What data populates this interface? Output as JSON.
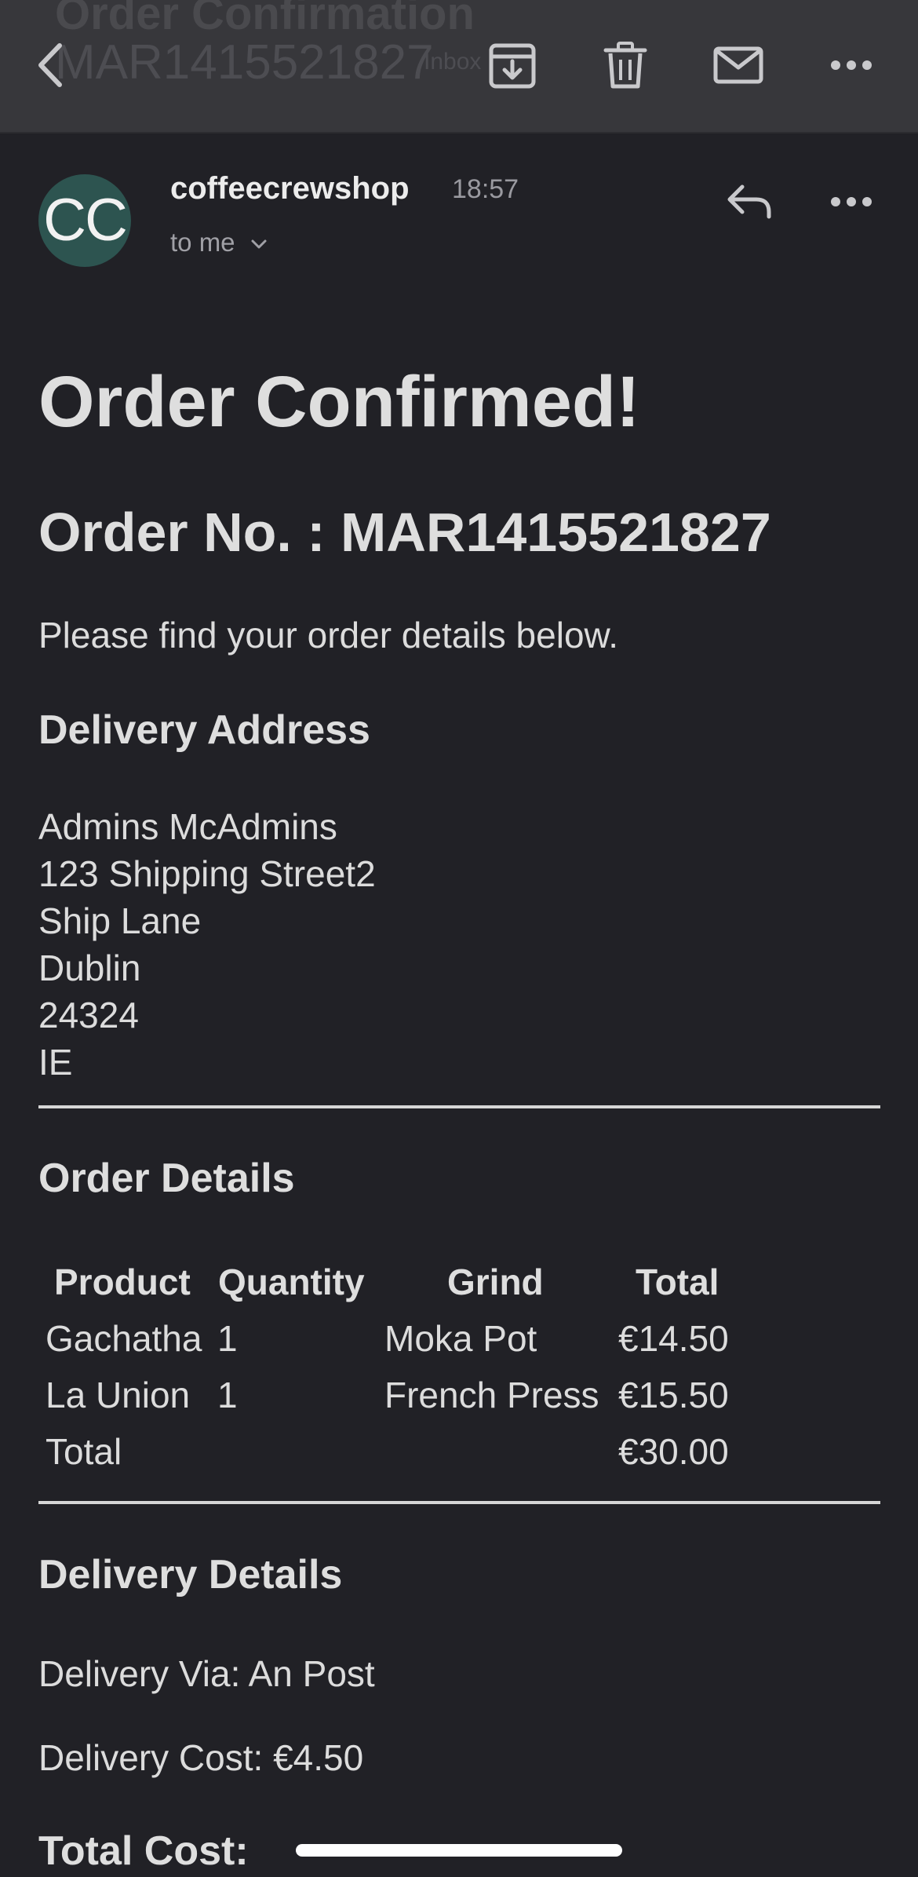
{
  "toolbar": {
    "ghost_subject": "Order Confirmation",
    "ghost_order": "MAR1415521827",
    "ghost_label": "Inbox",
    "icons": [
      "back-icon",
      "archive-icon",
      "trash-icon",
      "mail-icon",
      "more-icon"
    ]
  },
  "message": {
    "avatar_initials": "CC",
    "avatar_color": "#2d5450",
    "sender": "coffeecrewshop",
    "time": "18:57",
    "recipient": "to me"
  },
  "email": {
    "title": "Order Confirmed!",
    "order_number": "Order No. : MAR1415521827",
    "intro": "Please find your order details below.",
    "delivery_address": {
      "heading": "Delivery Address",
      "lines": [
        "Admins McAdmins",
        "123 Shipping Street2",
        "Ship Lane",
        "Dublin",
        "24324",
        "IE"
      ]
    },
    "order_details": {
      "heading": "Order Details",
      "columns": [
        "Product",
        "Quantity",
        "Grind",
        "Total"
      ],
      "rows": [
        {
          "product": "Gachatha",
          "quantity": "1",
          "grind": "Moka Pot",
          "total": "€14.50"
        },
        {
          "product": "La Union",
          "quantity": "1",
          "grind": "French Press",
          "total": "€15.50"
        }
      ],
      "total_label": "Total",
      "total_value": "€30.00"
    },
    "delivery_details": {
      "heading": "Delivery Details",
      "via": "Delivery Via: An Post",
      "cost": "Delivery Cost: €4.50"
    },
    "total_cost_label": "Total Cost:"
  }
}
